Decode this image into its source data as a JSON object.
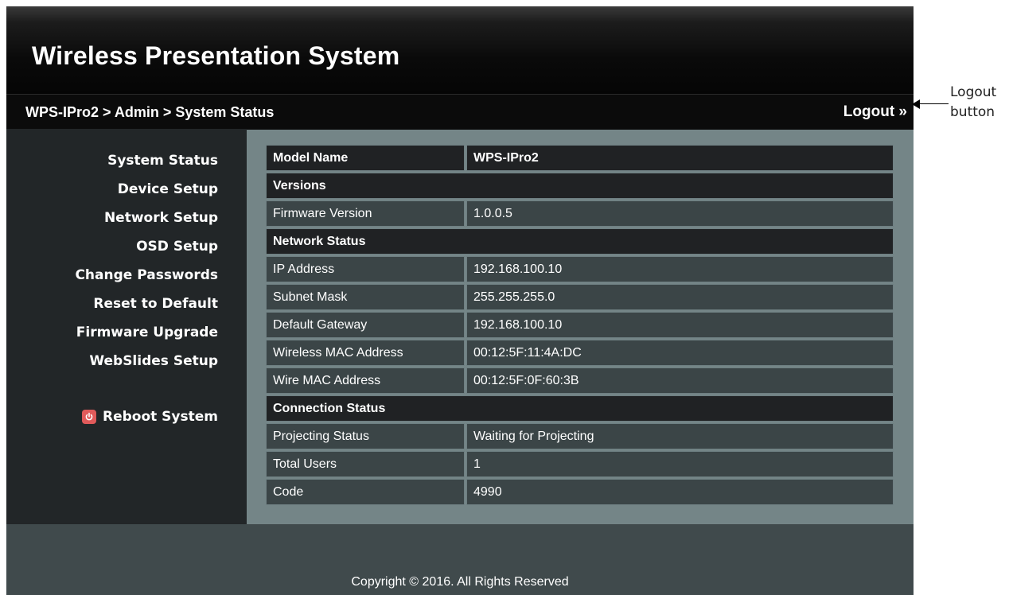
{
  "header": {
    "app_title": "Wireless Presentation System",
    "breadcrumb": "WPS-IPro2 > Admin > System Status",
    "logout_label": "Logout »"
  },
  "sidebar": {
    "items": [
      {
        "label": "System Status"
      },
      {
        "label": "Device Setup"
      },
      {
        "label": "Network Setup"
      },
      {
        "label": "OSD Setup"
      },
      {
        "label": "Change Passwords"
      },
      {
        "label": "Reset to Default"
      },
      {
        "label": "Firmware Upgrade"
      },
      {
        "label": "WebSlides Setup"
      }
    ],
    "reboot_label": "Reboot System",
    "reboot_icon": "power-icon"
  },
  "status_table": {
    "model_name_label": "Model Name",
    "model_name_value": "WPS-IPro2",
    "versions_header": "Versions",
    "firmware_version_label": "Firmware Version",
    "firmware_version_value": "1.0.0.5",
    "network_status_header": "Network Status",
    "ip_address_label": "IP Address",
    "ip_address_value": "192.168.100.10",
    "subnet_mask_label": "Subnet Mask",
    "subnet_mask_value": "255.255.255.0",
    "default_gateway_label": "Default Gateway",
    "default_gateway_value": "192.168.100.10",
    "wireless_mac_label": "Wireless MAC Address",
    "wireless_mac_value": "00:12:5F:11:4A:DC",
    "wire_mac_label": "Wire MAC Address",
    "wire_mac_value": "00:12:5F:0F:60:3B",
    "connection_status_header": "Connection Status",
    "projecting_status_label": "Projecting Status",
    "projecting_status_value": "Waiting for Projecting",
    "total_users_label": "Total Users",
    "total_users_value": "1",
    "code_label": "Code",
    "code_value": "4990"
  },
  "footer": {
    "copyright": "Copyright © 2016. All Rights Reserved"
  },
  "annotation": {
    "callout_text": "Logout\nbutton"
  },
  "colors": {
    "content_bg": "#748587",
    "sidebar_bg": "#222628",
    "table_header_bg": "#202224",
    "table_row_bg": "#3b4547",
    "reboot_icon": "#e05a5a"
  }
}
